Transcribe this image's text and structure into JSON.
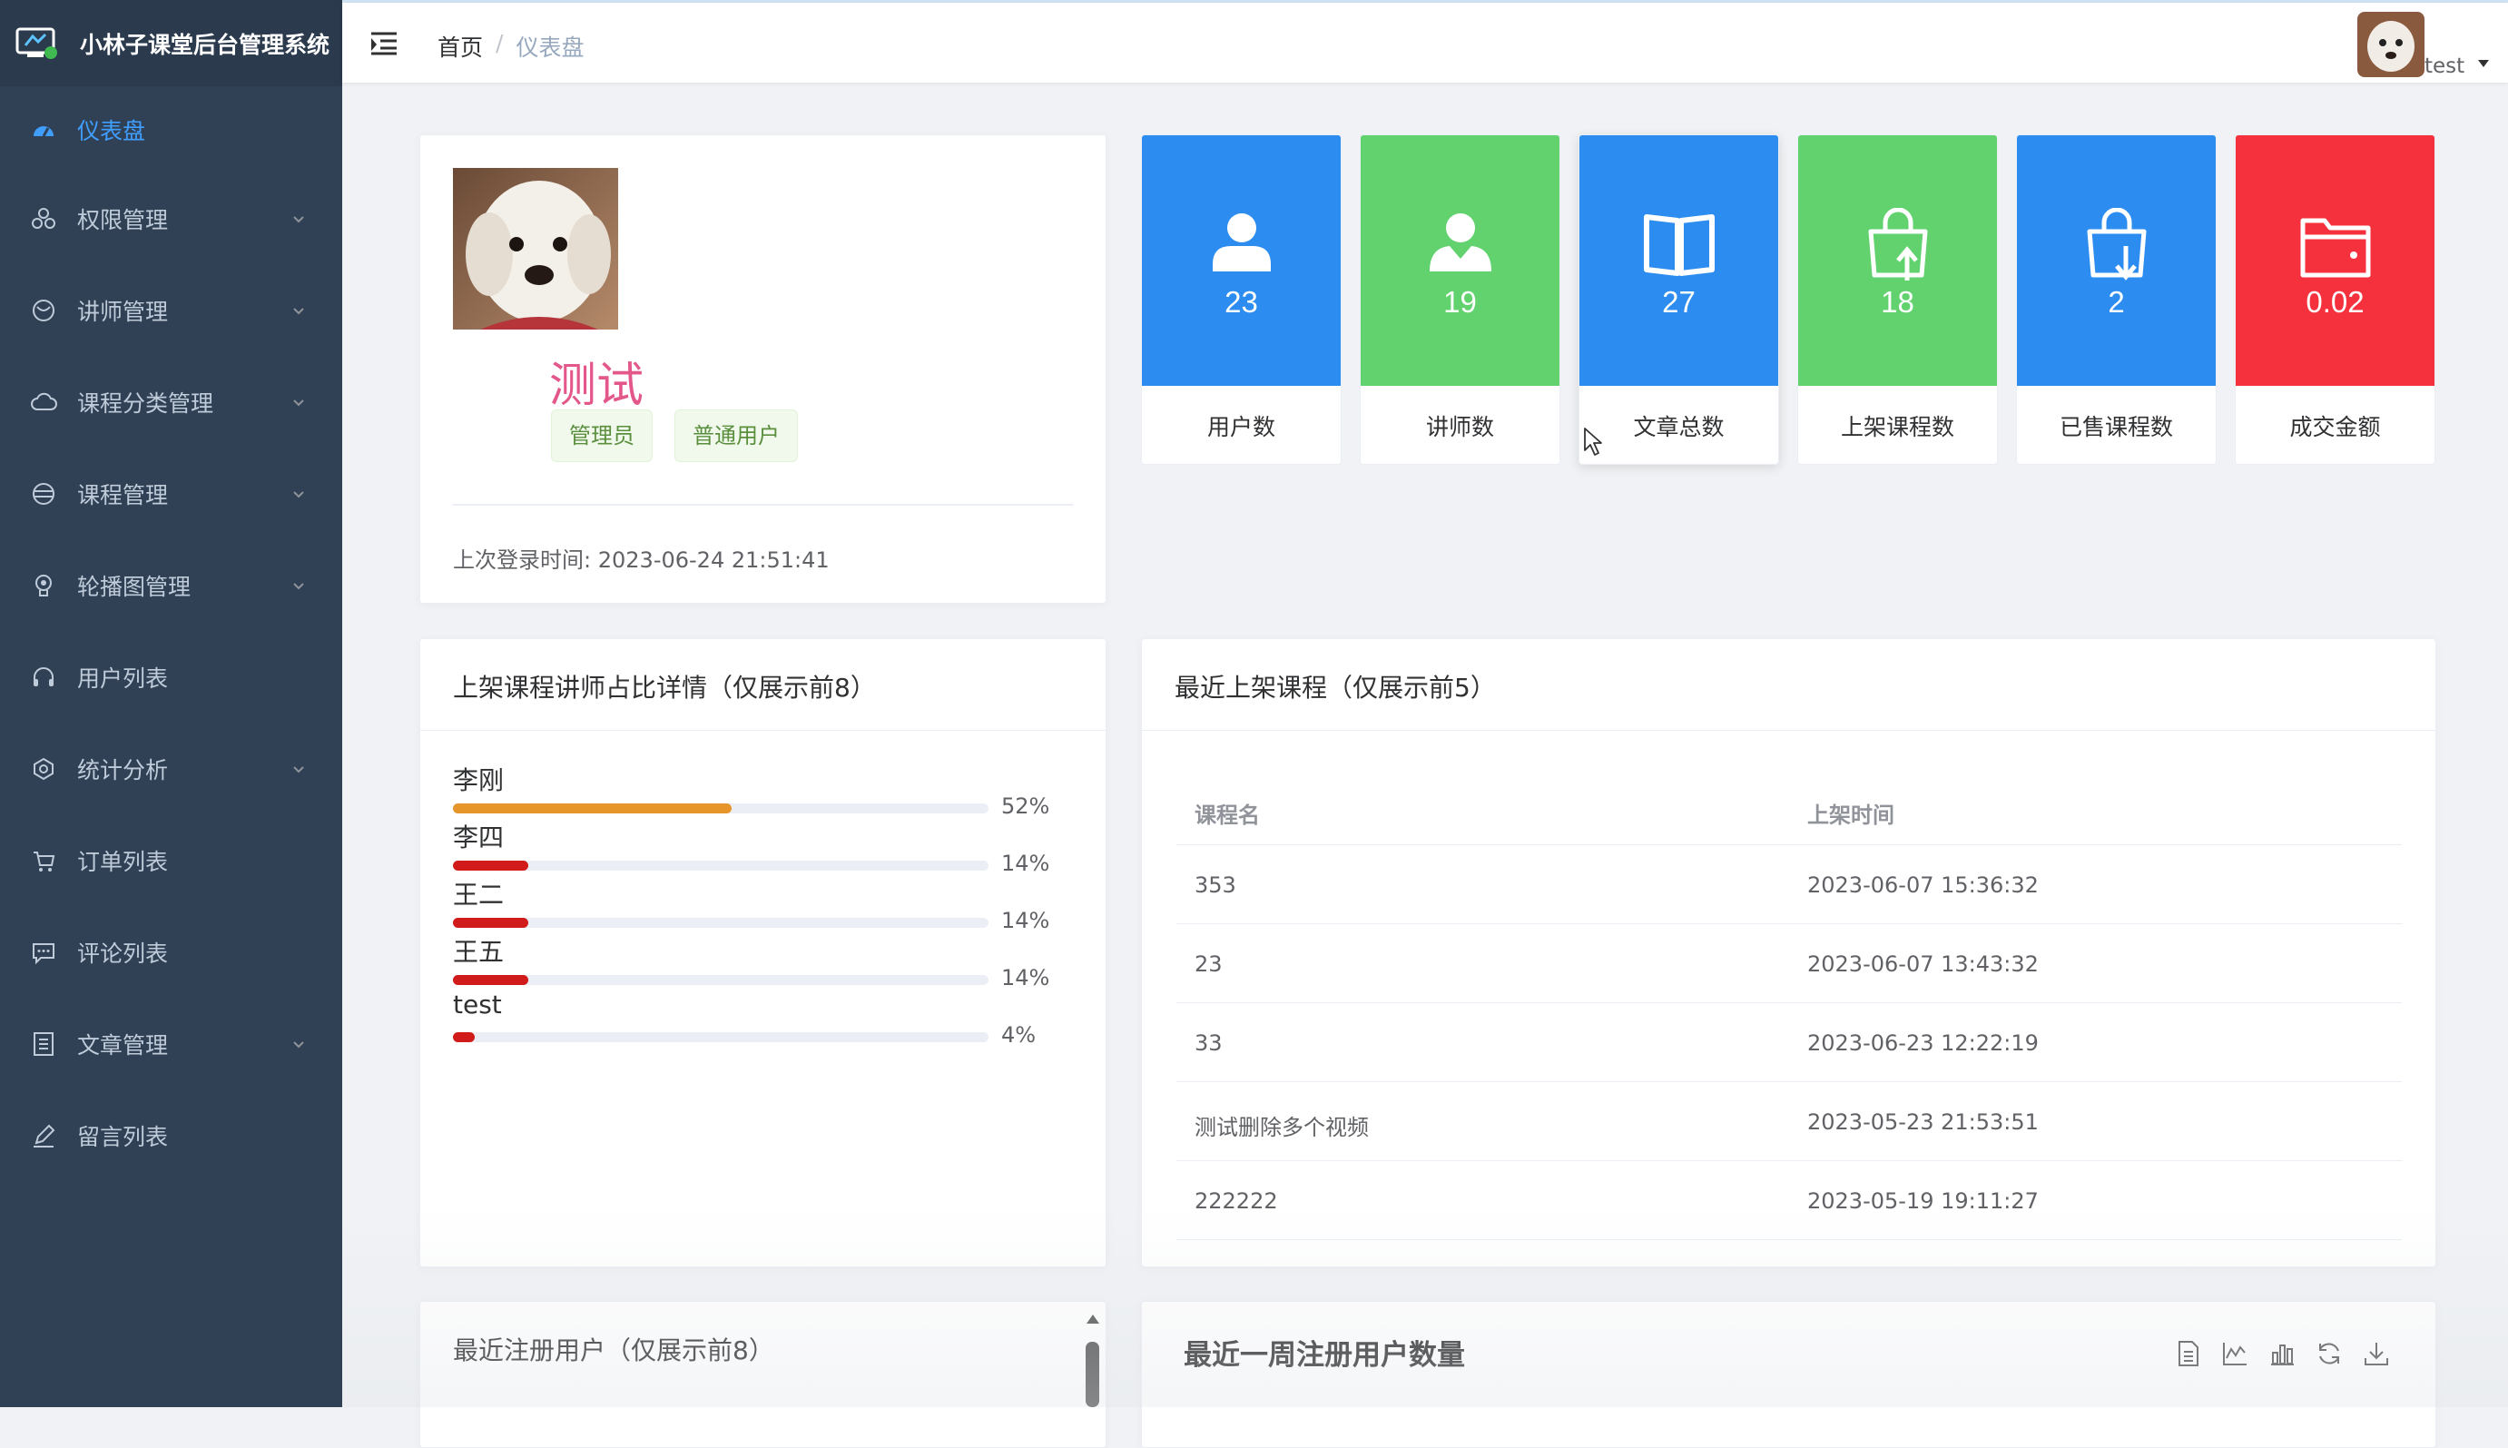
{
  "app": {
    "title": "小林子课堂后台管理系统"
  },
  "colors": {
    "sidebar_bg": "#304156",
    "accent": "#409eff",
    "blue": "#2d8cf0",
    "green": "#62d26f",
    "red": "#f5313d",
    "orange": "#e6952a",
    "bar_red": "#d11a1a"
  },
  "sidebar": {
    "items": [
      {
        "label": "仪表盘",
        "icon": "dashboard-icon",
        "active": true
      },
      {
        "label": "权限管理",
        "icon": "permission-icon",
        "expandable": true
      },
      {
        "label": "讲师管理",
        "icon": "teacher-icon",
        "expandable": true
      },
      {
        "label": "课程分类管理",
        "icon": "cloud-icon",
        "expandable": true
      },
      {
        "label": "课程管理",
        "icon": "course-icon",
        "expandable": true
      },
      {
        "label": "轮播图管理",
        "icon": "carousel-icon",
        "expandable": true
      },
      {
        "label": "用户列表",
        "icon": "headphone-icon",
        "expandable": false
      },
      {
        "label": "统计分析",
        "icon": "stats-icon",
        "expandable": true
      },
      {
        "label": "订单列表",
        "icon": "cart-icon",
        "expandable": false
      },
      {
        "label": "评论列表",
        "icon": "comment-icon",
        "expandable": false
      },
      {
        "label": "文章管理",
        "icon": "article-icon",
        "expandable": true
      },
      {
        "label": "留言列表",
        "icon": "edit-icon",
        "expandable": false
      }
    ]
  },
  "header": {
    "breadcrumb": {
      "home": "首页",
      "separator": "/",
      "current": "仪表盘"
    },
    "user": {
      "name": "test"
    }
  },
  "profile": {
    "name": "测试",
    "roles": [
      "管理员",
      "普通用户"
    ],
    "last_login_label": "上次登录时间:",
    "last_login": "2023-06-24 21:51:41"
  },
  "stats": [
    {
      "value": "23",
      "label": "用户数",
      "color": "#2d8cf0",
      "icon": "user-icon"
    },
    {
      "value": "19",
      "label": "讲师数",
      "color": "#62d26f",
      "icon": "teacher-user-icon"
    },
    {
      "value": "27",
      "label": "文章总数",
      "color": "#2d8cf0",
      "icon": "book-icon"
    },
    {
      "value": "18",
      "label": "上架课程数",
      "color": "#62d26f",
      "icon": "shopping-bag-up-icon"
    },
    {
      "value": "2",
      "label": "已售课程数",
      "color": "#2d8cf0",
      "icon": "shopping-bag-down-icon"
    },
    {
      "value": "0.02",
      "label": "成交金额",
      "color": "#f5313d",
      "icon": "wallet-icon"
    }
  ],
  "teacher_share": {
    "title": "上架课程讲师占比详情（仅展示前8）",
    "rows": [
      {
        "name": "李刚",
        "percent": 52,
        "percent_label": "52%",
        "color": "#e6952a"
      },
      {
        "name": "李四",
        "percent": 14,
        "percent_label": "14%",
        "color": "#d11a1a"
      },
      {
        "name": "王二",
        "percent": 14,
        "percent_label": "14%",
        "color": "#d11a1a"
      },
      {
        "name": "王五",
        "percent": 14,
        "percent_label": "14%",
        "color": "#d11a1a"
      },
      {
        "name": "test",
        "percent": 4,
        "percent_label": "4%",
        "color": "#d11a1a"
      }
    ]
  },
  "recent_courses": {
    "title": "最近上架课程（仅展示前5）",
    "columns": [
      "课程名",
      "上架时间"
    ],
    "rows": [
      [
        "353",
        "2023-06-07 15:36:32"
      ],
      [
        "23",
        "2023-06-07 13:43:32"
      ],
      [
        "33",
        "2023-06-23 12:22:19"
      ],
      [
        "测试删除多个视频",
        "2023-05-23 21:53:51"
      ],
      [
        "222222",
        "2023-05-19 19:11:27"
      ]
    ]
  },
  "recent_users": {
    "title": "最近注册用户（仅展示前8）"
  },
  "week_users": {
    "title": "最近一周注册用户数量",
    "tools": [
      "data-view-icon",
      "line-chart-icon",
      "bar-chart-icon",
      "refresh-icon",
      "download-icon"
    ]
  }
}
